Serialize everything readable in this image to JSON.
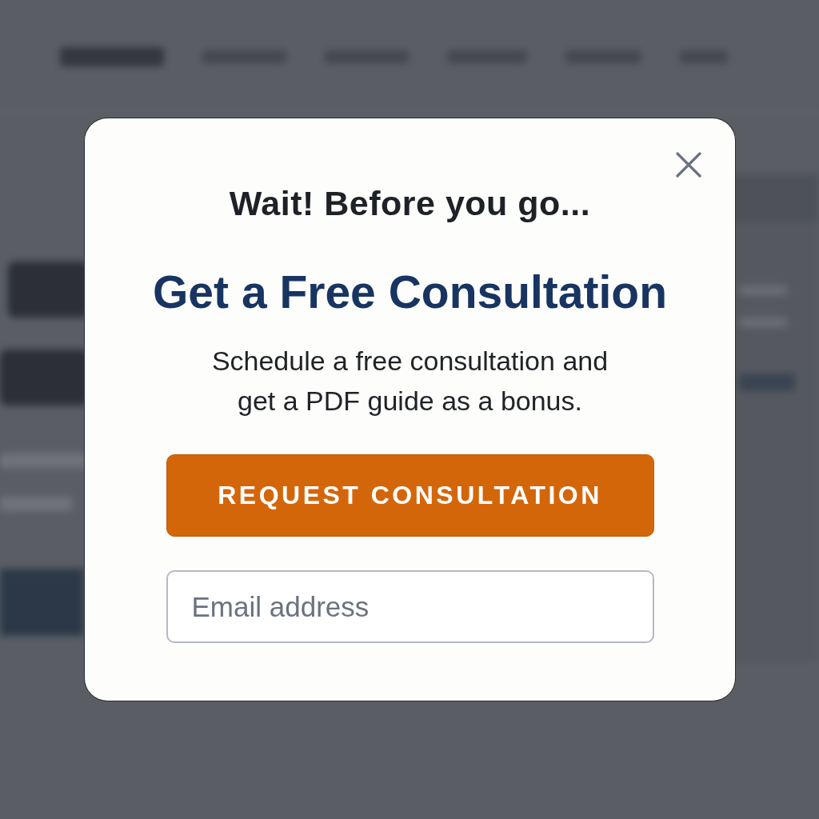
{
  "dialog": {
    "title": "Wait! Before you go...",
    "heading": "Get a Free Consultation",
    "description": "Schedule a free consultation and get a PDF guide as a bonus.",
    "button": {
      "label": "REQUEST CONSULTATION"
    },
    "email_field": {
      "placeholder": "Email address"
    }
  }
}
